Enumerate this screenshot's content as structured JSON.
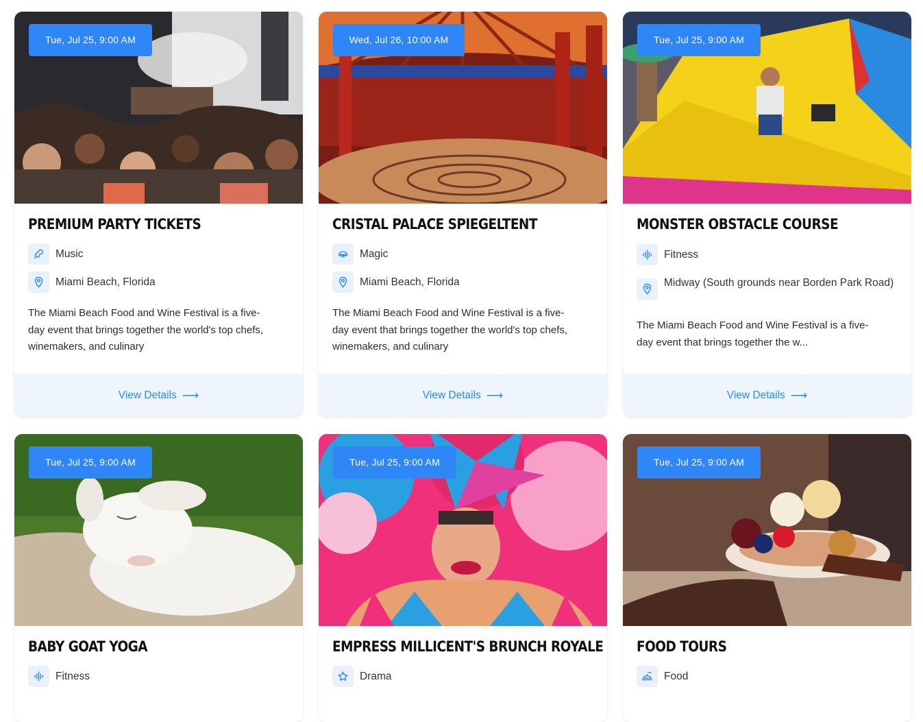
{
  "colors": {
    "accent": "#2f86f6",
    "icon_bg": "#e8f1fd",
    "footer_bg": "#eff5fd"
  },
  "cards": [
    {
      "date": "Tue, Jul 25, 9:00 AM",
      "title": "PREMIUM PARTY TICKETS",
      "category": "Music",
      "category_icon": "microphone-icon",
      "location": "Miami Beach, Florida",
      "description": "The Miami Beach Food and Wine Festival is a five-day event that brings together the world's top chefs, winemakers, and culinary",
      "cta": "View Details"
    },
    {
      "date": "Wed, Jul 26, 10:00 AM",
      "title": "CRISTAL PALACE SPIEGELTENT",
      "category": "Magic",
      "category_icon": "magic-hat-icon",
      "location": "Miami Beach, Florida",
      "description": "The Miami Beach Food and Wine Festival is a five-day event that brings together the world's top chefs, winemakers, and culinary",
      "cta": "View Details"
    },
    {
      "date": "Tue, Jul 25, 9:00 AM",
      "title": "MONSTER OBSTACLE COURSE",
      "category": "Fitness",
      "category_icon": "fitness-icon",
      "location": "Midway (South grounds near Borden Park Road)",
      "description": "The Miami Beach Food and Wine Festival is a five-day event that brings together the w...",
      "cta": "View Details"
    },
    {
      "date": "Tue, Jul 25, 9:00 AM",
      "title": "BABY GOAT YOGA",
      "category": "Fitness",
      "category_icon": "fitness-icon"
    },
    {
      "date": "Tue, Jul 25, 9:00 AM",
      "title": "EMPRESS MILLICENT'S BRUNCH ROYALE",
      "category": "Drama",
      "category_icon": "star-icon"
    },
    {
      "date": "Tue, Jul 25, 9:00 AM",
      "title": "FOOD TOURS",
      "category": "Food",
      "category_icon": "food-icon"
    }
  ]
}
